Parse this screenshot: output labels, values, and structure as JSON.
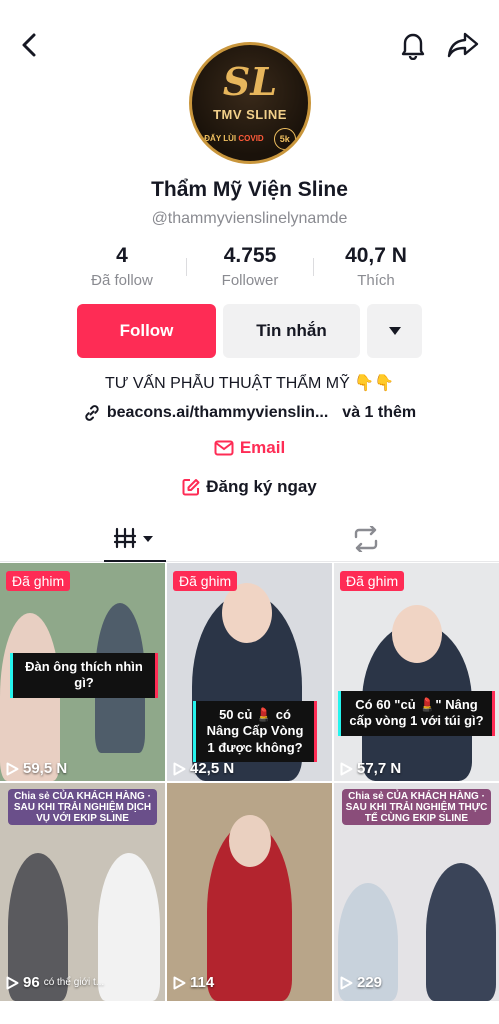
{
  "profile": {
    "avatar": {
      "monogram": "SL",
      "brand": "TMV SLINE",
      "badge_left": "ĐẨY LÙI",
      "badge_covid": "COVID",
      "badge_right": "5k"
    },
    "display_name": "Thẩm Mỹ Viện Sline",
    "handle": "@thammyvienslinelynamde",
    "stats": [
      {
        "value": "4",
        "label": "Đã follow"
      },
      {
        "value": "4.755",
        "label": "Follower"
      },
      {
        "value": "40,7 N",
        "label": "Thích"
      }
    ],
    "buttons": {
      "follow": "Follow",
      "message": "Tin nhắn"
    },
    "bio": "TƯ VẤN PHẪU THUẬT THẨM MỸ 👇👇",
    "link": {
      "url": "beacons.ai/thammyvienslin...",
      "more": "và 1 thêm"
    },
    "email_label": "Email",
    "signup_label": "Đăng ký ngay"
  },
  "colors": {
    "accent": "#fe2c55",
    "text": "#161823",
    "muted": "#8a8b91"
  },
  "videos": [
    {
      "pinned": "Đã ghim",
      "caption": "Đàn ông thích nhìn gì?",
      "views": "59,5 N",
      "bg": "#8fa88a"
    },
    {
      "pinned": "Đã ghim",
      "caption": "50 củ 💄 có Nâng Cấp Vòng 1 được không?",
      "views": "42,5 N",
      "bg": "#d9dbe0"
    },
    {
      "pinned": "Đã ghim",
      "caption": "Có 60 \"củ 💄\" Nâng cấp vòng 1 với túi gì?",
      "views": "57,7 N",
      "bg": "#e7e8ea"
    },
    {
      "banner": "Chia sẻ CỦA KHÁCH HÀNG · SAU KHI TRẢI NGHIỆM DỊCH VỤ VỚI EKIP SLINE",
      "views": "96",
      "sub": "có thể giới t...",
      "bg": "#c9c3b8"
    },
    {
      "views": "114",
      "bg": "#b8a589"
    },
    {
      "banner": "Chia sẻ CỦA KHÁCH HÀNG · SAU KHI TRẢI NGHIỆM THỰC TẾ CÙNG EKIP SLINE",
      "views": "229",
      "bg": "#e4e3e6"
    }
  ]
}
